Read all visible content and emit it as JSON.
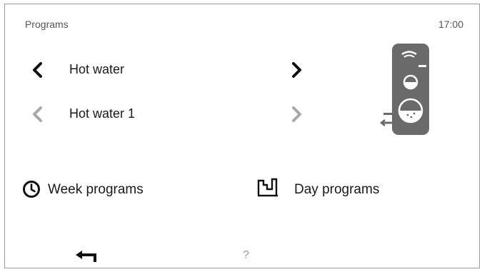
{
  "header": {
    "title": "Programs",
    "time": "17:00"
  },
  "selectors": [
    {
      "label": "Hot water",
      "enabled": true
    },
    {
      "label": "Hot water 1",
      "enabled": false
    }
  ],
  "sections": {
    "week": {
      "label": "Week programs",
      "icon": "clock-icon"
    },
    "day": {
      "label": "Day programs",
      "icon": "day-profile-icon"
    }
  },
  "footer": {
    "help": "?",
    "back_icon": "back-arrow-icon"
  },
  "colors": {
    "active": "#111111",
    "inactive": "#a8a8a8",
    "tank": "#6a6a6a"
  }
}
